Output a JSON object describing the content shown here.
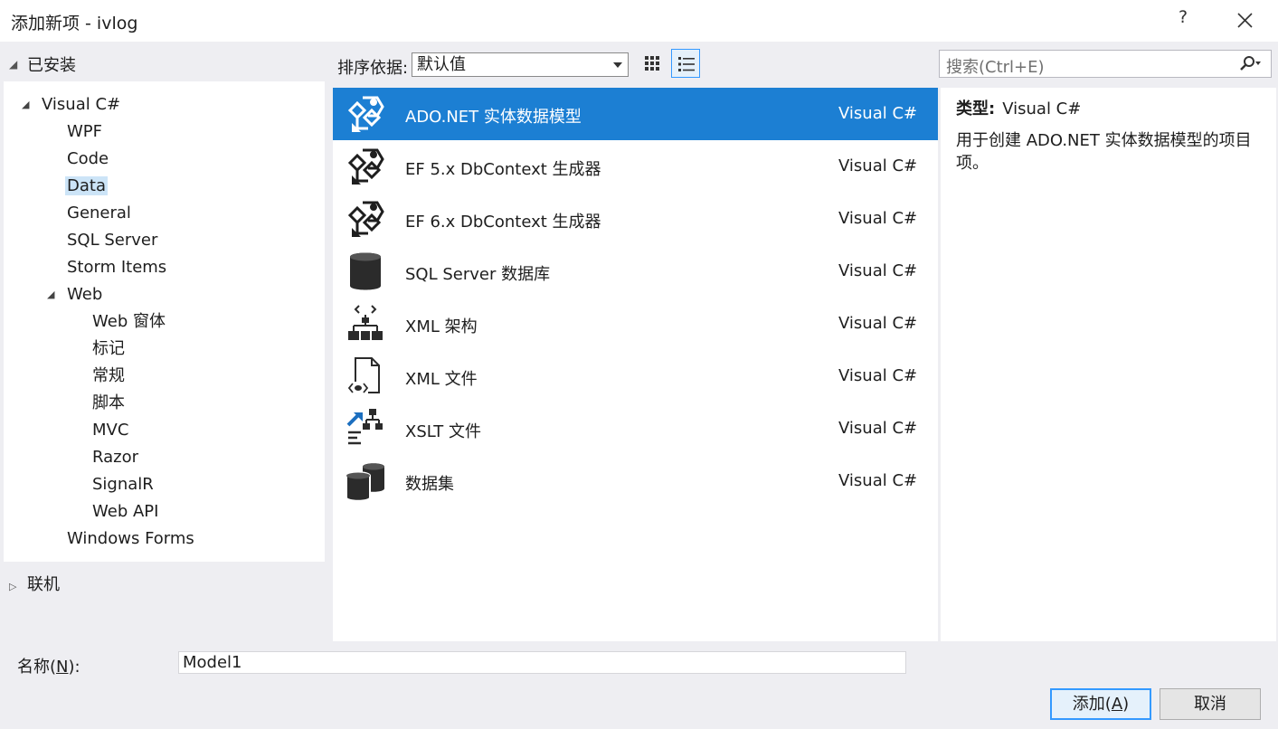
{
  "window": {
    "title": "添加新项 - ivlog",
    "help": "?"
  },
  "left": {
    "installed_label": "已安装",
    "tree": [
      {
        "label": "Visual C#",
        "level": 1,
        "expander": "◢"
      },
      {
        "label": "WPF",
        "level": 2
      },
      {
        "label": "Code",
        "level": 2
      },
      {
        "label": "Data",
        "level": 2,
        "selected": true
      },
      {
        "label": "General",
        "level": 2
      },
      {
        "label": "SQL Server",
        "level": 2
      },
      {
        "label": "Storm Items",
        "level": 2
      },
      {
        "label": "Web",
        "level": 2,
        "expander": "◢"
      },
      {
        "label": "Web 窗体",
        "level": 3
      },
      {
        "label": "标记",
        "level": 3
      },
      {
        "label": "常规",
        "level": 3
      },
      {
        "label": "脚本",
        "level": 3
      },
      {
        "label": "MVC",
        "level": 3
      },
      {
        "label": "Razor",
        "level": 3
      },
      {
        "label": "SignalR",
        "level": 3
      },
      {
        "label": "Web API",
        "level": 3
      },
      {
        "label": "Windows Forms",
        "level": 2
      }
    ],
    "online_label": "联机"
  },
  "toolbar": {
    "sort_label": "排序依据:",
    "sort_value": "默认值",
    "search_placeholder": "搜索(Ctrl+E)"
  },
  "items": [
    {
      "name": "ADO.NET 实体数据模型",
      "type": "Visual C#",
      "icon": "entity-model-icon",
      "selected": true
    },
    {
      "name": "EF 5.x DbContext 生成器",
      "type": "Visual C#",
      "icon": "entity-model-icon"
    },
    {
      "name": "EF 6.x DbContext 生成器",
      "type": "Visual C#",
      "icon": "entity-model-icon"
    },
    {
      "name": "SQL Server 数据库",
      "type": "Visual C#",
      "icon": "database-icon"
    },
    {
      "name": "XML 架构",
      "type": "Visual C#",
      "icon": "xml-schema-icon"
    },
    {
      "name": "XML 文件",
      "type": "Visual C#",
      "icon": "xml-file-icon"
    },
    {
      "name": "XSLT 文件",
      "type": "Visual C#",
      "icon": "xslt-icon"
    },
    {
      "name": "数据集",
      "type": "Visual C#",
      "icon": "dataset-icon"
    }
  ],
  "details": {
    "type_label": "类型:",
    "type_value": "Visual C#",
    "description": "用于创建 ADO.NET 实体数据模型的项目项。"
  },
  "footer": {
    "name_label_prefix": "名称(",
    "name_label_key": "N",
    "name_label_suffix": "):",
    "name_value": "Model1",
    "add_prefix": "添加(",
    "add_key": "A",
    "add_suffix": ")",
    "cancel_label": "取消"
  },
  "colors": {
    "selection": "#1c7fd3",
    "tree_selection": "#cce4f7",
    "accent": "#3399ff"
  }
}
